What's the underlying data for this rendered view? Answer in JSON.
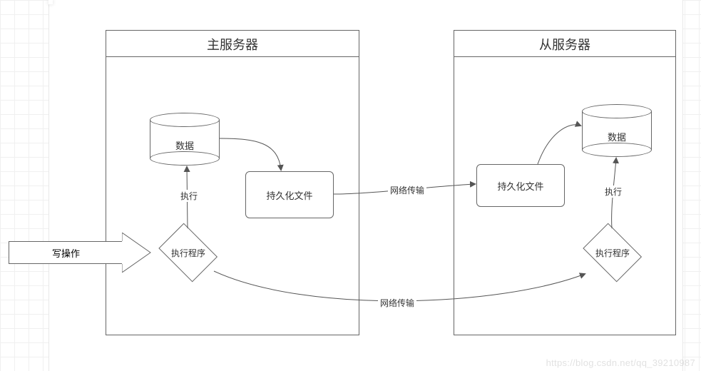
{
  "diagram": {
    "master": {
      "title": "主服务器",
      "data_label": "数据",
      "persist_label": "持久化文件",
      "exec_prog_label": "执行程序",
      "exec_edge": "执行"
    },
    "slave": {
      "title": "从服务器",
      "data_label": "数据",
      "persist_label": "持久化文件",
      "exec_prog_label": "执行程序",
      "exec_edge": "执行"
    },
    "write_op": "写操作",
    "net_top": "网络传输",
    "net_bottom": "网络传输"
  },
  "watermark": "https://blog.csdn.net/qq_39210987"
}
